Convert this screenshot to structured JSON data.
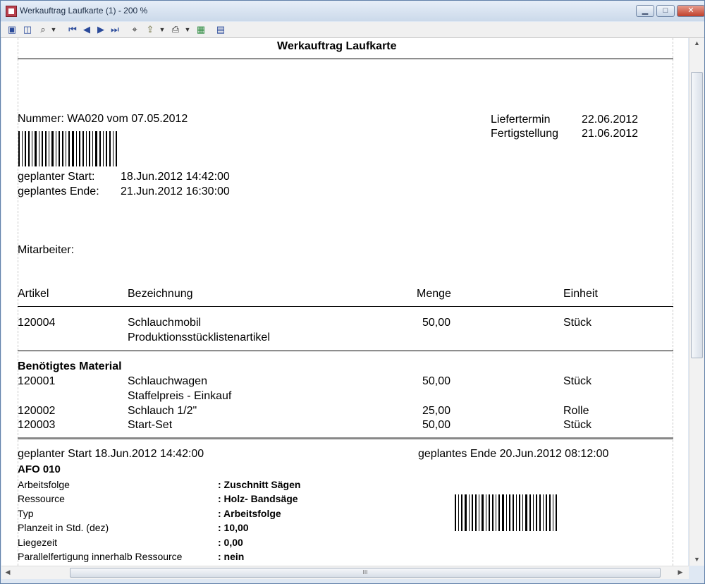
{
  "window": {
    "title": "Werkauftrag Laufkarte (1) - 200 %",
    "min_label": "▁",
    "max_label": "□",
    "close_label": "✕"
  },
  "toolbar": {
    "icons": [
      "page-icon",
      "two-pages-icon",
      "zoom-icon",
      "chevron-down-icon",
      "first-page-icon",
      "prev-page-icon",
      "next-page-icon",
      "last-page-icon",
      "find-icon",
      "export-icon",
      "chevron-down-icon",
      "print-icon",
      "chevron-down-icon",
      "excel-icon",
      "save-icon"
    ]
  },
  "doc": {
    "title": "Werkauftrag Laufkarte",
    "number_line": "Nummer: WA020 vom 07.05.2012",
    "liefertermin_label": "Liefertermin",
    "liefertermin_value": "22.06.2012",
    "fertig_label": "Fertigstellung",
    "fertig_value": "21.06.2012",
    "start_label": "geplanter Start:",
    "start_value": "18.Jun.2012 14:42:00",
    "ende_label": "geplantes Ende:",
    "ende_value": "21.Jun.2012 16:30:00",
    "mitarbeiter_label": "Mitarbeiter:",
    "columns": {
      "artikel": "Artikel",
      "bezeichnung": "Bezeichnung",
      "menge": "Menge",
      "einheit": "Einheit"
    },
    "main_item": {
      "artikel": "120004",
      "bezeichnung": "Schlauchmobil",
      "bezeichnung2": "Produktionsstücklistenartikel",
      "menge": "50,00",
      "einheit": "Stück"
    },
    "material_heading": "Benötigtes Material",
    "materials": [
      {
        "artikel": "120001",
        "bezeichnung": "Schlauchwagen",
        "bezeichnung2": "Staffelpreis - Einkauf",
        "menge": "50,00",
        "einheit": "Stück"
      },
      {
        "artikel": "120002",
        "bezeichnung": "Schlauch 1/2\"",
        "menge": "25,00",
        "einheit": "Rolle"
      },
      {
        "artikel": "120003",
        "bezeichnung": "Start-Set",
        "menge": "50,00",
        "einheit": "Stück"
      }
    ],
    "afo_start": "geplanter Start 18.Jun.2012 14:42:00",
    "afo_ende": "geplantes Ende 20.Jun.2012 08:12:00",
    "afo_title": "AFO 010",
    "afo_rows": [
      {
        "label": "Arbeitsfolge",
        "value": ": Zuschnitt Sägen"
      },
      {
        "label": "Ressource",
        "value": ": Holz- Bandsäge"
      },
      {
        "label": "Typ",
        "value": ": Arbeitsfolge"
      },
      {
        "label": "Planzeit in Std. (dez)",
        "value": ": 10,00"
      },
      {
        "label": "Liegezeit",
        "value": ": 0,00"
      },
      {
        "label": "Parallelfertigung innerhalb Ressource",
        "value": ": nein"
      }
    ]
  },
  "scrollbars": {
    "h_grip": "III"
  },
  "colors": {
    "title_bar": "#cbd9ea",
    "close_button": "#c0412c",
    "toolbar_icon": "#2a4a9a"
  }
}
